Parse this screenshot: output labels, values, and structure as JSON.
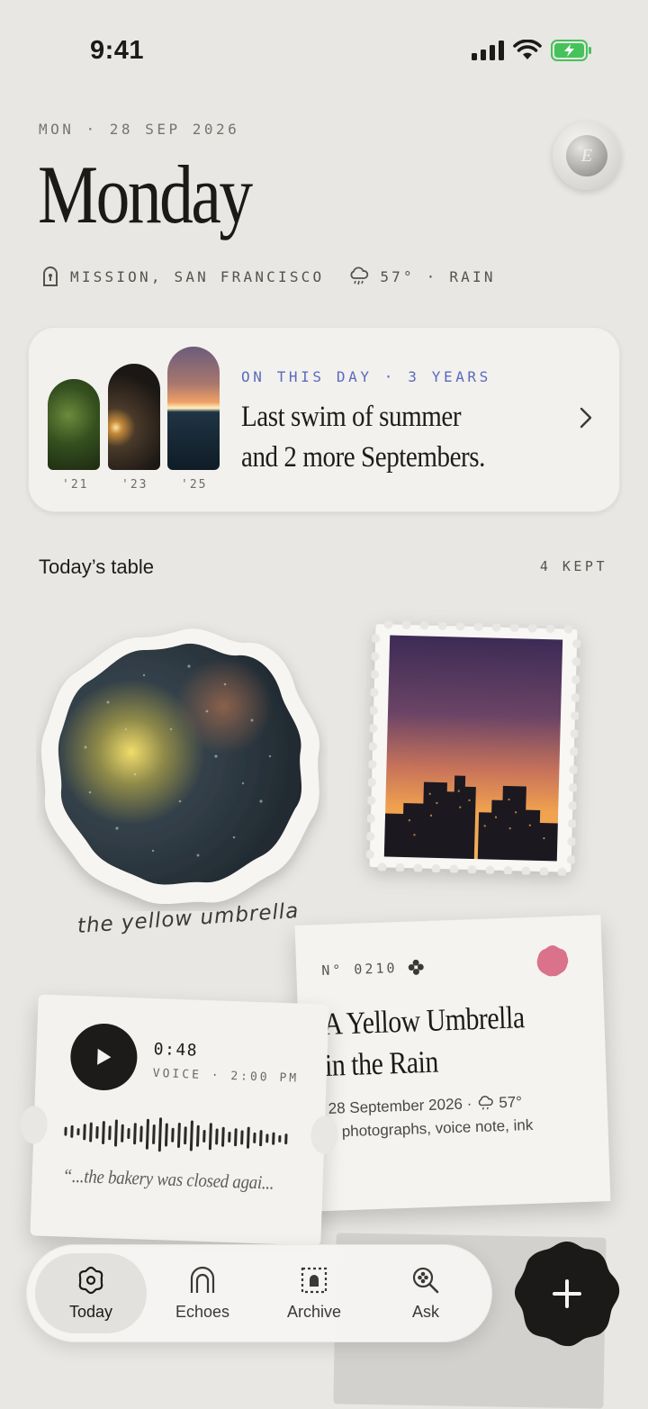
{
  "status_bar": {
    "time": "9:41"
  },
  "header": {
    "date_line": "MON · 28 SEP 2026",
    "title": "Monday",
    "avatar_letter": "E",
    "location": "MISSION, SAN FRANCISCO",
    "weather": "57° · RAIN"
  },
  "on_this_day": {
    "kicker": "ON THIS DAY · 3 YEARS",
    "text": "Last swim of summer and 2 more Septembers.",
    "years": [
      "'21",
      "'23",
      "'25"
    ]
  },
  "section": {
    "title": "Today’s table",
    "count": "4 KEPT"
  },
  "sticker": {
    "caption": "the yellow umbrella"
  },
  "note": {
    "number": "N° 0210",
    "title": "A Yellow Umbrella in the Rain",
    "date": "28 September 2026 ·",
    "temp": "57°",
    "contents": "2 photographs, voice note, ink",
    "accent": "#d9728a"
  },
  "voice": {
    "duration": "0:48",
    "meta": "VOICE · 2:00 PM",
    "quote": "“...the bakery was closed agai..."
  },
  "tabs": [
    {
      "label": "Today",
      "icon": "flower-icon"
    },
    {
      "label": "Echoes",
      "icon": "arch-icon"
    },
    {
      "label": "Archive",
      "icon": "archive-icon"
    },
    {
      "label": "Ask",
      "icon": "ask-search-icon"
    }
  ],
  "fab": {
    "icon": "plus-icon"
  }
}
